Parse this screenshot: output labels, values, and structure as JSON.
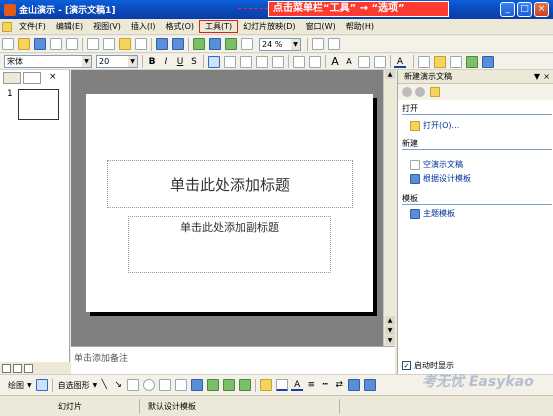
{
  "window": {
    "title": "金山演示 - [演示文稿1]",
    "buttons": [
      "_",
      "□",
      "×"
    ]
  },
  "callout": "点击菜单栏“工具”  →  “选项”",
  "menu": [
    "文件(F)",
    "编辑(E)",
    "视图(V)",
    "插入(I)",
    "格式(O)",
    "工具(T)",
    "幻灯片放映(D)",
    "窗口(W)",
    "帮助(H)"
  ],
  "toolbar": {
    "zoom": "24 %",
    "font": "宋体",
    "size": "20",
    "bold": "B",
    "italic": "I",
    "underline": "U",
    "shadow": "S",
    "grow": "A",
    "shrink": "A",
    "fontcolor": "A"
  },
  "left_pane": {
    "slide_number": "1"
  },
  "slide": {
    "title_placeholder": "单击此处添加标题",
    "subtitle_placeholder": "单击此处添加副标题"
  },
  "notes": "单击添加备注",
  "task_pane": {
    "header": "新建演示文稿",
    "sections": [
      {
        "title": "打开",
        "links": [
          "打开(O)..."
        ]
      },
      {
        "title": "新建",
        "links": [
          "空演示文稿",
          "根据设计模板"
        ]
      },
      {
        "title": "模板",
        "links": [
          "主题模板"
        ]
      }
    ],
    "startup_label": "启动时显示",
    "startup_checked": true
  },
  "drawing_bar": {
    "draw_label": "绘图",
    "autoshape_label": "自选图形"
  },
  "status_bar": [
    "幻灯片",
    "默认设计模板"
  ],
  "watermark": "考无忧 Easykao"
}
